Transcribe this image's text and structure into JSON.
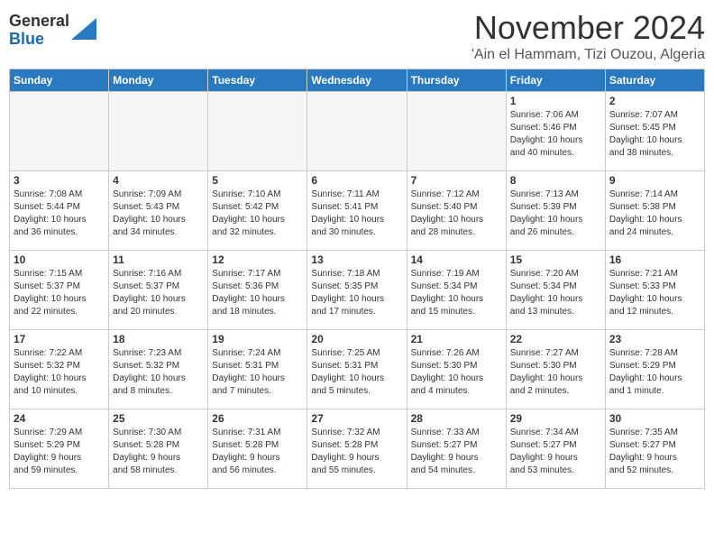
{
  "header": {
    "logo_line1": "General",
    "logo_line2": "Blue",
    "month": "November 2024",
    "location": "'Ain el Hammam, Tizi Ouzou, Algeria"
  },
  "weekdays": [
    "Sunday",
    "Monday",
    "Tuesday",
    "Wednesday",
    "Thursday",
    "Friday",
    "Saturday"
  ],
  "weeks": [
    [
      {
        "day": "",
        "info": "",
        "empty": true
      },
      {
        "day": "",
        "info": "",
        "empty": true
      },
      {
        "day": "",
        "info": "",
        "empty": true
      },
      {
        "day": "",
        "info": "",
        "empty": true
      },
      {
        "day": "",
        "info": "",
        "empty": true
      },
      {
        "day": "1",
        "info": "Sunrise: 7:06 AM\nSunset: 5:46 PM\nDaylight: 10 hours\nand 40 minutes.",
        "empty": false
      },
      {
        "day": "2",
        "info": "Sunrise: 7:07 AM\nSunset: 5:45 PM\nDaylight: 10 hours\nand 38 minutes.",
        "empty": false
      }
    ],
    [
      {
        "day": "3",
        "info": "Sunrise: 7:08 AM\nSunset: 5:44 PM\nDaylight: 10 hours\nand 36 minutes.",
        "empty": false
      },
      {
        "day": "4",
        "info": "Sunrise: 7:09 AM\nSunset: 5:43 PM\nDaylight: 10 hours\nand 34 minutes.",
        "empty": false
      },
      {
        "day": "5",
        "info": "Sunrise: 7:10 AM\nSunset: 5:42 PM\nDaylight: 10 hours\nand 32 minutes.",
        "empty": false
      },
      {
        "day": "6",
        "info": "Sunrise: 7:11 AM\nSunset: 5:41 PM\nDaylight: 10 hours\nand 30 minutes.",
        "empty": false
      },
      {
        "day": "7",
        "info": "Sunrise: 7:12 AM\nSunset: 5:40 PM\nDaylight: 10 hours\nand 28 minutes.",
        "empty": false
      },
      {
        "day": "8",
        "info": "Sunrise: 7:13 AM\nSunset: 5:39 PM\nDaylight: 10 hours\nand 26 minutes.",
        "empty": false
      },
      {
        "day": "9",
        "info": "Sunrise: 7:14 AM\nSunset: 5:38 PM\nDaylight: 10 hours\nand 24 minutes.",
        "empty": false
      }
    ],
    [
      {
        "day": "10",
        "info": "Sunrise: 7:15 AM\nSunset: 5:37 PM\nDaylight: 10 hours\nand 22 minutes.",
        "empty": false
      },
      {
        "day": "11",
        "info": "Sunrise: 7:16 AM\nSunset: 5:37 PM\nDaylight: 10 hours\nand 20 minutes.",
        "empty": false
      },
      {
        "day": "12",
        "info": "Sunrise: 7:17 AM\nSunset: 5:36 PM\nDaylight: 10 hours\nand 18 minutes.",
        "empty": false
      },
      {
        "day": "13",
        "info": "Sunrise: 7:18 AM\nSunset: 5:35 PM\nDaylight: 10 hours\nand 17 minutes.",
        "empty": false
      },
      {
        "day": "14",
        "info": "Sunrise: 7:19 AM\nSunset: 5:34 PM\nDaylight: 10 hours\nand 15 minutes.",
        "empty": false
      },
      {
        "day": "15",
        "info": "Sunrise: 7:20 AM\nSunset: 5:34 PM\nDaylight: 10 hours\nand 13 minutes.",
        "empty": false
      },
      {
        "day": "16",
        "info": "Sunrise: 7:21 AM\nSunset: 5:33 PM\nDaylight: 10 hours\nand 12 minutes.",
        "empty": false
      }
    ],
    [
      {
        "day": "17",
        "info": "Sunrise: 7:22 AM\nSunset: 5:32 PM\nDaylight: 10 hours\nand 10 minutes.",
        "empty": false
      },
      {
        "day": "18",
        "info": "Sunrise: 7:23 AM\nSunset: 5:32 PM\nDaylight: 10 hours\nand 8 minutes.",
        "empty": false
      },
      {
        "day": "19",
        "info": "Sunrise: 7:24 AM\nSunset: 5:31 PM\nDaylight: 10 hours\nand 7 minutes.",
        "empty": false
      },
      {
        "day": "20",
        "info": "Sunrise: 7:25 AM\nSunset: 5:31 PM\nDaylight: 10 hours\nand 5 minutes.",
        "empty": false
      },
      {
        "day": "21",
        "info": "Sunrise: 7:26 AM\nSunset: 5:30 PM\nDaylight: 10 hours\nand 4 minutes.",
        "empty": false
      },
      {
        "day": "22",
        "info": "Sunrise: 7:27 AM\nSunset: 5:30 PM\nDaylight: 10 hours\nand 2 minutes.",
        "empty": false
      },
      {
        "day": "23",
        "info": "Sunrise: 7:28 AM\nSunset: 5:29 PM\nDaylight: 10 hours\nand 1 minute.",
        "empty": false
      }
    ],
    [
      {
        "day": "24",
        "info": "Sunrise: 7:29 AM\nSunset: 5:29 PM\nDaylight: 9 hours\nand 59 minutes.",
        "empty": false
      },
      {
        "day": "25",
        "info": "Sunrise: 7:30 AM\nSunset: 5:28 PM\nDaylight: 9 hours\nand 58 minutes.",
        "empty": false
      },
      {
        "day": "26",
        "info": "Sunrise: 7:31 AM\nSunset: 5:28 PM\nDaylight: 9 hours\nand 56 minutes.",
        "empty": false
      },
      {
        "day": "27",
        "info": "Sunrise: 7:32 AM\nSunset: 5:28 PM\nDaylight: 9 hours\nand 55 minutes.",
        "empty": false
      },
      {
        "day": "28",
        "info": "Sunrise: 7:33 AM\nSunset: 5:27 PM\nDaylight: 9 hours\nand 54 minutes.",
        "empty": false
      },
      {
        "day": "29",
        "info": "Sunrise: 7:34 AM\nSunset: 5:27 PM\nDaylight: 9 hours\nand 53 minutes.",
        "empty": false
      },
      {
        "day": "30",
        "info": "Sunrise: 7:35 AM\nSunset: 5:27 PM\nDaylight: 9 hours\nand 52 minutes.",
        "empty": false
      }
    ]
  ]
}
